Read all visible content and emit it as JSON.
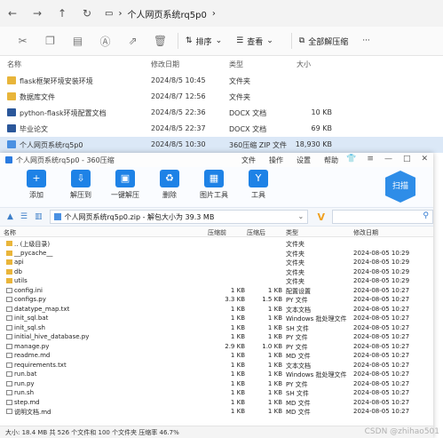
{
  "explorer": {
    "path_title": "个人网页系统rq5p0",
    "toolbar": {
      "sort_label": "排序",
      "view_label": "查看",
      "extract_all_label": "全部解压缩",
      "more": "···"
    },
    "columns": [
      "名称",
      "修改日期",
      "类型",
      "大小"
    ],
    "rows": [
      {
        "icon": "folder-icon",
        "name": "flask框架环境安装环境",
        "date": "2024/8/5 10:45",
        "type": "文件夹",
        "size": ""
      },
      {
        "icon": "folder-icon",
        "name": "数据库文件",
        "date": "2024/8/7 12:56",
        "type": "文件夹",
        "size": ""
      },
      {
        "icon": "docx-icon",
        "name": "python-flask环境配置文档",
        "date": "2024/8/5 22:36",
        "type": "DOCX 文档",
        "size": "10 KB"
      },
      {
        "icon": "docx-icon",
        "name": "毕业论文",
        "date": "2024/8/5 22:37",
        "type": "DOCX 文档",
        "size": "69 KB"
      },
      {
        "icon": "zip-icon",
        "name": "个人网页系统rq5p0",
        "date": "2024/8/5 10:30",
        "type": "360压缩 ZIP 文件",
        "size": "18,930 KB"
      }
    ]
  },
  "zip_window": {
    "title": "个人网页系统rq5p0 - 360压缩",
    "menu": [
      "文件",
      "操作",
      "设置",
      "帮助"
    ],
    "tools": [
      {
        "label": "添加",
        "icon": "add-icon"
      },
      {
        "label": "解压到",
        "icon": "extract-to-icon"
      },
      {
        "label": "一键解压",
        "icon": "quick-extract-icon"
      },
      {
        "label": "删除",
        "icon": "delete-icon"
      },
      {
        "label": "图片工具",
        "icon": "image-tool-icon"
      },
      {
        "label": "工具",
        "icon": "tools-icon"
      }
    ],
    "scan_label": "扫描",
    "address": "个人网页系统rq5p0.zip - 解包大小为 39.3 MB",
    "columns": [
      "名称",
      "压缩前",
      "压缩后",
      "类型",
      "修改日期"
    ],
    "rows": [
      {
        "icon": "folder",
        "name": ".. (上级目录)",
        "before": "",
        "after": "",
        "type": "文件夹",
        "date": ""
      },
      {
        "icon": "folder",
        "name": "__pycache__",
        "before": "",
        "after": "",
        "type": "文件夹",
        "date": "2024-08-05 10:29"
      },
      {
        "icon": "folder",
        "name": "api",
        "before": "",
        "after": "",
        "type": "文件夹",
        "date": "2024-08-05 10:29"
      },
      {
        "icon": "folder",
        "name": "db",
        "before": "",
        "after": "",
        "type": "文件夹",
        "date": "2024-08-05 10:29"
      },
      {
        "icon": "folder",
        "name": "utils",
        "before": "",
        "after": "",
        "type": "文件夹",
        "date": "2024-08-05 10:29"
      },
      {
        "icon": "file",
        "name": "config.ini",
        "before": "1 KB",
        "after": "1 KB",
        "type": "配置设置",
        "date": "2024-08-05 10:27"
      },
      {
        "icon": "file",
        "name": "configs.py",
        "before": "3.3 KB",
        "after": "1.5 KB",
        "type": "PY 文件",
        "date": "2024-08-05 10:27"
      },
      {
        "icon": "file",
        "name": "datatype_map.txt",
        "before": "1 KB",
        "after": "1 KB",
        "type": "文本文档",
        "date": "2024-08-05 10:27"
      },
      {
        "icon": "file",
        "name": "init_sql.bat",
        "before": "1 KB",
        "after": "1 KB",
        "type": "Windows 批处理文件",
        "date": "2024-08-05 10:27"
      },
      {
        "icon": "file",
        "name": "init_sql.sh",
        "before": "1 KB",
        "after": "1 KB",
        "type": "SH 文件",
        "date": "2024-08-05 10:27"
      },
      {
        "icon": "file",
        "name": "initial_hive_database.py",
        "before": "1 KB",
        "after": "1 KB",
        "type": "PY 文件",
        "date": "2024-08-05 10:27"
      },
      {
        "icon": "file",
        "name": "manage.py",
        "before": "2.9 KB",
        "after": "1.0 KB",
        "type": "PY 文件",
        "date": "2024-08-05 10:27"
      },
      {
        "icon": "file",
        "name": "readme.md",
        "before": "1 KB",
        "after": "1 KB",
        "type": "MD 文件",
        "date": "2024-08-05 10:27"
      },
      {
        "icon": "file",
        "name": "requirements.txt",
        "before": "1 KB",
        "after": "1 KB",
        "type": "文本文档",
        "date": "2024-08-05 10:27"
      },
      {
        "icon": "file",
        "name": "run.bat",
        "before": "1 KB",
        "after": "1 KB",
        "type": "Windows 批处理文件",
        "date": "2024-08-05 10:27"
      },
      {
        "icon": "file",
        "name": "run.py",
        "before": "1 KB",
        "after": "1 KB",
        "type": "PY 文件",
        "date": "2024-08-05 10:27"
      },
      {
        "icon": "file",
        "name": "run.sh",
        "before": "1 KB",
        "after": "1 KB",
        "type": "SH 文件",
        "date": "2024-08-05 10:27"
      },
      {
        "icon": "file",
        "name": "step.md",
        "before": "1 KB",
        "after": "1 KB",
        "type": "MD 文件",
        "date": "2024-08-05 10:27"
      },
      {
        "icon": "file",
        "name": "说明文档.md",
        "before": "1 KB",
        "after": "1 KB",
        "type": "MD 文件",
        "date": "2024-08-05 10:27"
      }
    ],
    "status": "大小: 18.4 MB 共 526 个文件和 100 个文件夹 压缩率 46.7%"
  },
  "watermark": "CSDN @zhihao501"
}
